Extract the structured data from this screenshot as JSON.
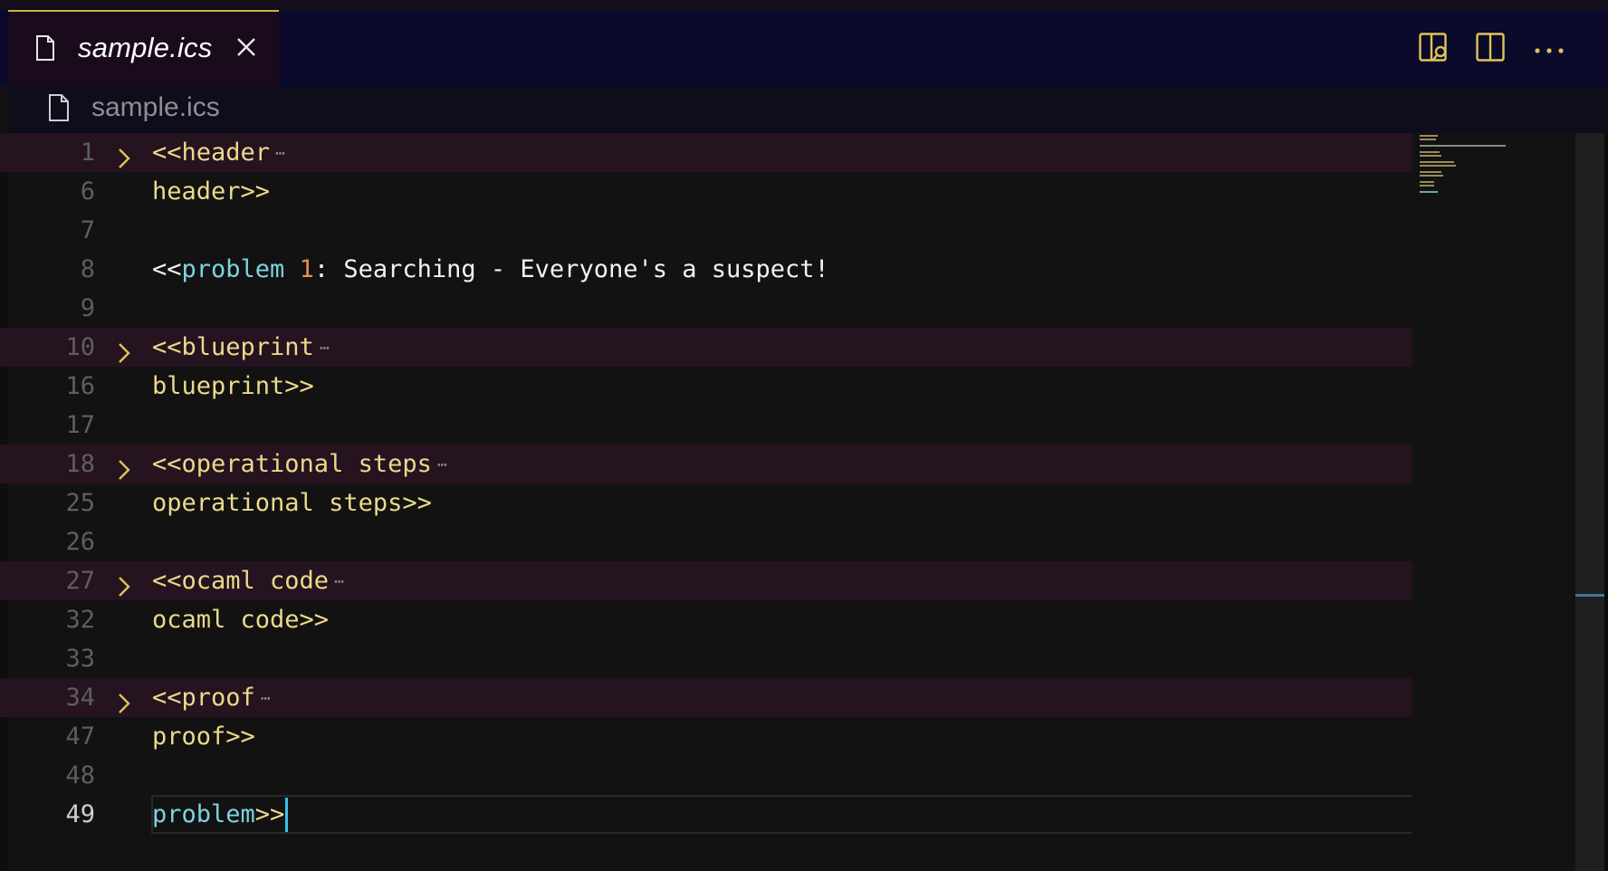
{
  "tab": {
    "title": "sample.ics"
  },
  "breadcrumb": {
    "file": "sample.ics"
  },
  "colors": {
    "tab_border": "#c9b24a",
    "keyword": "#7dd3e0",
    "text": "#ecd98b",
    "number": "#f08a4b",
    "caret": "#39c2e6",
    "fold_highlight": "#251320"
  },
  "actions": [
    "open-preview-icon",
    "split-editor-icon",
    "more-actions-icon"
  ],
  "lines": [
    {
      "num": "1",
      "fold": true
    },
    {
      "num": "6",
      "fold": false
    },
    {
      "num": "7",
      "fold": false
    },
    {
      "num": "8",
      "fold": false
    },
    {
      "num": "9",
      "fold": false
    },
    {
      "num": "10",
      "fold": true
    },
    {
      "num": "16",
      "fold": false
    },
    {
      "num": "17",
      "fold": false
    },
    {
      "num": "18",
      "fold": true
    },
    {
      "num": "25",
      "fold": false
    },
    {
      "num": "26",
      "fold": false
    },
    {
      "num": "27",
      "fold": true
    },
    {
      "num": "32",
      "fold": false
    },
    {
      "num": "33",
      "fold": false
    },
    {
      "num": "34",
      "fold": true
    },
    {
      "num": "47",
      "fold": false
    },
    {
      "num": "48",
      "fold": false
    },
    {
      "num": "49",
      "fold": false
    }
  ],
  "code": {
    "header_open": "<<header",
    "header_close": "header>>",
    "problem_open_prefix": "<<",
    "problem_kw": "problem",
    "problem_num": "1",
    "problem_title": ": Searching - Everyone's a suspect!",
    "blueprint_open": "<<blueprint",
    "blueprint_close": "blueprint>>",
    "steps_open": "<<operational steps",
    "steps_close": "operational steps>>",
    "ocaml_open": "<<ocaml code",
    "ocaml_close": "ocaml code>>",
    "proof_open": "<<proof",
    "proof_close": "proof>>",
    "problem_close_kw": "problem",
    "problem_close_end": ">>"
  },
  "fold_ellipsis": "⋯"
}
